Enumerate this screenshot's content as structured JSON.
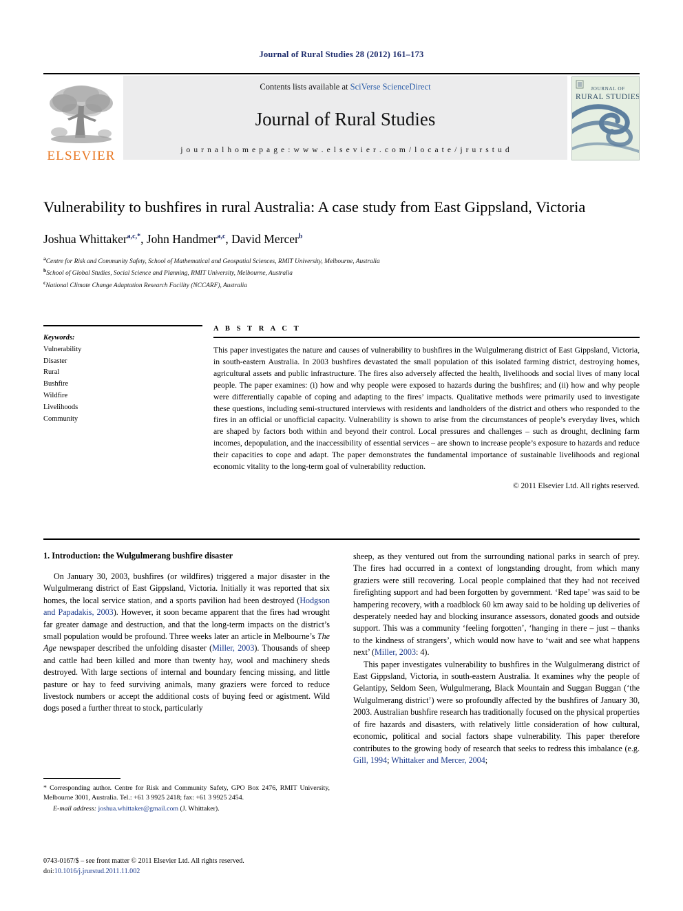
{
  "running_head": "Journal of Rural Studies 28 (2012) 161–173",
  "masthead": {
    "publisher_name": "ELSEVIER",
    "contents_prefix": "Contents lists available at ",
    "contents_link": "SciVerse ScienceDirect",
    "journal_name": "Journal of Rural Studies",
    "homepage_label": "j o u r n a l   h o m e p a g e :   w w w . e l s e v i e r . c o m / l o c a t e / j r u r s t u d",
    "cover_line1": "JOURNAL OF",
    "cover_line2": "RURAL STUDIES"
  },
  "article": {
    "title": "Vulnerability to bushfires in rural Australia: A case study from East Gippsland, Victoria",
    "authors": [
      {
        "name": "Joshua Whittaker",
        "marks": "a,c,*"
      },
      {
        "name": "John Handmer",
        "marks": "a,c"
      },
      {
        "name": "David Mercer",
        "marks": "b"
      }
    ],
    "affiliations": [
      {
        "mark": "a",
        "text": "Centre for Risk and Community Safety, School of Mathematical and Geospatial Sciences, RMIT University, Melbourne, Australia"
      },
      {
        "mark": "b",
        "text": "School of Global Studies, Social Science and Planning, RMIT University, Melbourne, Australia"
      },
      {
        "mark": "c",
        "text": "National Climate Change Adaptation Research Facility (NCCARF), Australia"
      }
    ]
  },
  "keywords": {
    "heading": "Keywords:",
    "items": [
      "Vulnerability",
      "Disaster",
      "Rural",
      "Bushfire",
      "Wildfire",
      "Livelihoods",
      "Community"
    ]
  },
  "abstract": {
    "label": "A B S T R A C T",
    "text": "This paper investigates the nature and causes of vulnerability to bushfires in the Wulgulmerang district of East Gippsland, Victoria, in south-eastern Australia. In 2003 bushfires devastated the small population of this isolated farming district, destroying homes, agricultural assets and public infrastructure. The fires also adversely affected the health, livelihoods and social lives of many local people. The paper examines: (i) how and why people were exposed to hazards during the bushfires; and (ii) how and why people were differentially capable of coping and adapting to the fires’ impacts. Qualitative methods were primarily used to investigate these questions, including semi-structured interviews with residents and landholders of the district and others who responded to the fires in an official or unofficial capacity. Vulnerability is shown to arise from the circumstances of people’s everyday lives, which are shaped by factors both within and beyond their control. Local pressures and challenges – such as drought, declining farm incomes, depopulation, and the inaccessibility of essential services – are shown to increase people’s exposure to hazards and reduce their capacities to cope and adapt. The paper demonstrates the fundamental importance of sustainable livelihoods and regional economic vitality to the long-term goal of vulnerability reduction.",
    "copyright": "© 2011 Elsevier Ltd. All rights reserved."
  },
  "body": {
    "section_heading": "1. Introduction: the Wulgulmerang bushfire disaster",
    "left_paragraph": {
      "part1": "On January 30, 2003, bushfires (or wildfires) triggered a major disaster in the Wulgulmerang district of East Gippsland, Victoria. Initially it was reported that six homes, the local service station, and a sports pavilion had been destroyed (",
      "cite1": "Hodgson and Papadakis, 2003",
      "part2": "). However, it soon became apparent that the fires had wrought far greater damage and destruction, and that the long-term impacts on the district’s small population would be profound. Three weeks later an article in Melbourne’s ",
      "italic1": "The Age",
      "part3": " newspaper described the unfolding disaster (",
      "cite2": "Miller, 2003",
      "part4": "). Thousands of sheep and cattle had been killed and more than twenty hay, wool and machinery sheds destroyed. With large sections of internal and boundary fencing missing, and little pasture or hay to feed surviving animals, many graziers were forced to reduce livestock numbers or accept the additional costs of buying feed or agistment. Wild dogs posed a further threat to stock, particularly"
    },
    "right_paragraph_1": {
      "part1": "sheep, as they ventured out from the surrounding national parks in search of prey. The fires had occurred in a context of longstanding drought, from which many graziers were still recovering. Local people complained that they had not received firefighting support and had been forgotten by government. ‘Red tape’ was said to be hampering recovery, with a roadblock 60 km away said to be holding up deliveries of desperately needed hay and blocking insurance assessors, donated goods and outside support. This was a community ‘feeling forgotten’, ‘hanging in there – just – thanks to the kindness of strangers’, which would now have to ‘wait and see what happens next’ (",
      "cite1": "Miller, 2003",
      "part2": ": 4)."
    },
    "right_paragraph_2": {
      "part1": "This paper investigates vulnerability to bushfires in the Wulgulmerang district of East Gippsland, Victoria, in south-eastern Australia. It examines why the people of Gelantipy, Seldom Seen, Wulgulmerang, Black Mountain and Suggan Buggan (‘the Wulgulmerang district’) were so profoundly affected by the bushfires of January 30, 2003. Australian bushfire research has traditionally focused on the physical properties of fire hazards and disasters, with relatively little consideration of how cultural, economic, political and social factors shape vulnerability. This paper therefore contributes to the growing body of research that seeks to redress this imbalance (e.g. ",
      "cite1": "Gill, 1994",
      "sep1": "; ",
      "cite2": "Whittaker and Mercer, 2004",
      "part2": ";"
    }
  },
  "footnote": {
    "corresponding": "* Corresponding author. Centre for Risk and Community Safety, GPO Box 2476, RMIT University, Melbourne 3001, Australia. Tel.: +61 3 9925 2418; fax: +61 3 9925 2454.",
    "email_label": "E-mail address:",
    "email": "joshua.whittaker@gmail.com",
    "email_suffix": " (J. Whittaker)."
  },
  "footer": {
    "issn_line": "0743-0167/$ – see front matter © 2011 Elsevier Ltd. All rights reserved.",
    "doi_prefix": "doi:",
    "doi": "10.1016/j.jrurstud.2011.11.002"
  },
  "colors": {
    "running_head": "#1b2a6b",
    "link": "#2a5ca8",
    "citation": "#1b3a8c",
    "elsevier_orange": "#e87722",
    "contents_bg": "#ececed",
    "cover_bg": "#e6efe2",
    "cover_wave": "#5d7f9e"
  }
}
